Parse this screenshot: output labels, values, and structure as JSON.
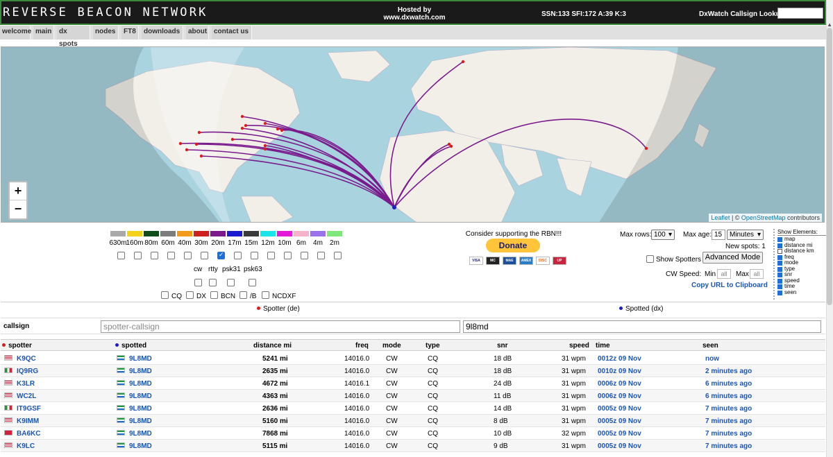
{
  "header": {
    "logo": "REVERSE BEACON NETWORK",
    "hosted_line1": "Hosted by",
    "hosted_line2": "www.dxwatch.com",
    "solar": "SSN:133 SFI:172 A:39 K:3",
    "lookup_label": "DxWatch Callsign Lookup:",
    "lookup_value": ""
  },
  "nav": [
    {
      "label": "welcome"
    },
    {
      "label": "main"
    },
    {
      "label": "dx spots"
    },
    {
      "label": "nodes"
    },
    {
      "label": "FT8"
    },
    {
      "label": "downloads"
    },
    {
      "label": "about"
    },
    {
      "label": "contact us"
    }
  ],
  "map": {
    "zoom_in": "+",
    "zoom_out": "−",
    "attribution_leaflet": "Leaflet",
    "attribution_sep": " | © ",
    "attribution_osm": "OpenStreetMap",
    "attribution_tail": " contributors",
    "spot_color": "#7a1a8c",
    "dx_color": "#1c1cc8",
    "spotter_color": "#e01a1a"
  },
  "bands": [
    {
      "label": "630m",
      "color": "#a9a9a9",
      "checked": false
    },
    {
      "label": "160m",
      "color": "#f2d21b",
      "checked": false
    },
    {
      "label": "80m",
      "color": "#0f4d1a",
      "checked": false
    },
    {
      "label": "60m",
      "color": "#7c7c7c",
      "checked": false
    },
    {
      "label": "40m",
      "color": "#f29a1a",
      "checked": false
    },
    {
      "label": "30m",
      "color": "#cf2020",
      "checked": false
    },
    {
      "label": "20m",
      "color": "#7a1a8c",
      "checked": true
    },
    {
      "label": "17m",
      "color": "#1a1acf",
      "checked": false
    },
    {
      "label": "15m",
      "color": "#3a3a3a",
      "checked": false
    },
    {
      "label": "12m",
      "color": "#1ae6ea",
      "checked": false
    },
    {
      "label": "10m",
      "color": "#e41ad9",
      "checked": false
    },
    {
      "label": "6m",
      "color": "#f5b3c9",
      "checked": false
    },
    {
      "label": "4m",
      "color": "#9a73ea",
      "checked": false
    },
    {
      "label": "2m",
      "color": "#7ee87a",
      "checked": false
    }
  ],
  "modes": [
    {
      "label": "cw",
      "checked": false
    },
    {
      "label": "rtty",
      "checked": false
    },
    {
      "label": "psk31",
      "checked": false
    },
    {
      "label": "psk63",
      "checked": false
    }
  ],
  "types": [
    {
      "label": "CQ",
      "checked": false
    },
    {
      "label": "DX",
      "checked": false
    },
    {
      "label": "BCN",
      "checked": false
    },
    {
      "label": "/B",
      "checked": false
    },
    {
      "label": "NCDXF",
      "checked": false
    }
  ],
  "donate": {
    "text": "Consider supporting the RBN!!!",
    "button": "Donate",
    "cards": [
      "VISA",
      "MC",
      "MAE",
      "AMEX",
      "DISC",
      "UP"
    ]
  },
  "controls": {
    "max_rows_label": "Max rows:",
    "max_rows_value": "100",
    "max_age_label": "Max age:",
    "max_age_value": "15",
    "max_age_unit": "Minutes",
    "new_spots": "New spots: 1",
    "show_spotters": "Show Spotters",
    "advanced_mode": "Advanced Mode",
    "cw_speed_label": "CW Speed:",
    "min_label": "Min",
    "min_placeholder": "all",
    "max_label": "Max",
    "max_placeholder": "all",
    "copy_url": "Copy URL to Clipboard"
  },
  "show_elements": {
    "title": "Show Elements:",
    "items": [
      {
        "label": "map",
        "checked": true
      },
      {
        "label": "distance mi",
        "checked": true
      },
      {
        "label": "distance km",
        "checked": false
      },
      {
        "label": "freq",
        "checked": true
      },
      {
        "label": "mode",
        "checked": true
      },
      {
        "label": "type",
        "checked": true
      },
      {
        "label": "snr",
        "checked": true
      },
      {
        "label": "speed",
        "checked": true
      },
      {
        "label": "time",
        "checked": true
      },
      {
        "label": "seen",
        "checked": true
      }
    ]
  },
  "table": {
    "spotter_head": "Spotter (de)",
    "spotted_head": "Spotted (dx)",
    "callsign_label": "callsign",
    "spotter_placeholder": "spotter-callsign",
    "spotted_value": "9l8md",
    "columns": {
      "spotter": "spotter",
      "spotted": "spotted",
      "distance": "distance mi",
      "freq": "freq",
      "mode": "mode",
      "type": "type",
      "snr": "snr",
      "speed": "speed",
      "time": "time",
      "seen": "seen"
    },
    "rows": [
      {
        "spotter": "K9QC",
        "flag": "us",
        "spotted": "9L8MD",
        "distance": "5241 mi",
        "freq": "14016.0",
        "mode": "CW",
        "type": "CQ",
        "snr": "18 dB",
        "speed": "31 wpm",
        "time": "0012z 09 Nov",
        "seen": "now"
      },
      {
        "spotter": "IQ9RG",
        "flag": "it",
        "spotted": "9L8MD",
        "distance": "2635 mi",
        "freq": "14016.0",
        "mode": "CW",
        "type": "CQ",
        "snr": "18 dB",
        "speed": "31 wpm",
        "time": "0010z 09 Nov",
        "seen": "2 minutes ago"
      },
      {
        "spotter": "K3LR",
        "flag": "us",
        "spotted": "9L8MD",
        "distance": "4672 mi",
        "freq": "14016.1",
        "mode": "CW",
        "type": "CQ",
        "snr": "24 dB",
        "speed": "31 wpm",
        "time": "0006z 09 Nov",
        "seen": "6 minutes ago"
      },
      {
        "spotter": "WC2L",
        "flag": "us",
        "spotted": "9L8MD",
        "distance": "4363 mi",
        "freq": "14016.0",
        "mode": "CW",
        "type": "CQ",
        "snr": "11 dB",
        "speed": "31 wpm",
        "time": "0006z 09 Nov",
        "seen": "6 minutes ago"
      },
      {
        "spotter": "IT9GSF",
        "flag": "it",
        "spotted": "9L8MD",
        "distance": "2636 mi",
        "freq": "14016.0",
        "mode": "CW",
        "type": "CQ",
        "snr": "14 dB",
        "speed": "31 wpm",
        "time": "0005z 09 Nov",
        "seen": "7 minutes ago"
      },
      {
        "spotter": "K9IMM",
        "flag": "us",
        "spotted": "9L8MD",
        "distance": "5160 mi",
        "freq": "14016.0",
        "mode": "CW",
        "type": "CQ",
        "snr": "8 dB",
        "speed": "31 wpm",
        "time": "0005z 09 Nov",
        "seen": "7 minutes ago"
      },
      {
        "spotter": "BA6KC",
        "flag": "cn",
        "spotted": "9L8MD",
        "distance": "7868 mi",
        "freq": "14016.0",
        "mode": "CW",
        "type": "CQ",
        "snr": "10 dB",
        "speed": "32 wpm",
        "time": "0005z 09 Nov",
        "seen": "7 minutes ago"
      },
      {
        "spotter": "K9LC",
        "flag": "us",
        "spotted": "9L8MD",
        "distance": "5115 mi",
        "freq": "14016.0",
        "mode": "CW",
        "type": "CQ",
        "snr": "9 dB",
        "speed": "31 wpm",
        "time": "0005z 09 Nov",
        "seen": "7 minutes ago"
      }
    ]
  }
}
